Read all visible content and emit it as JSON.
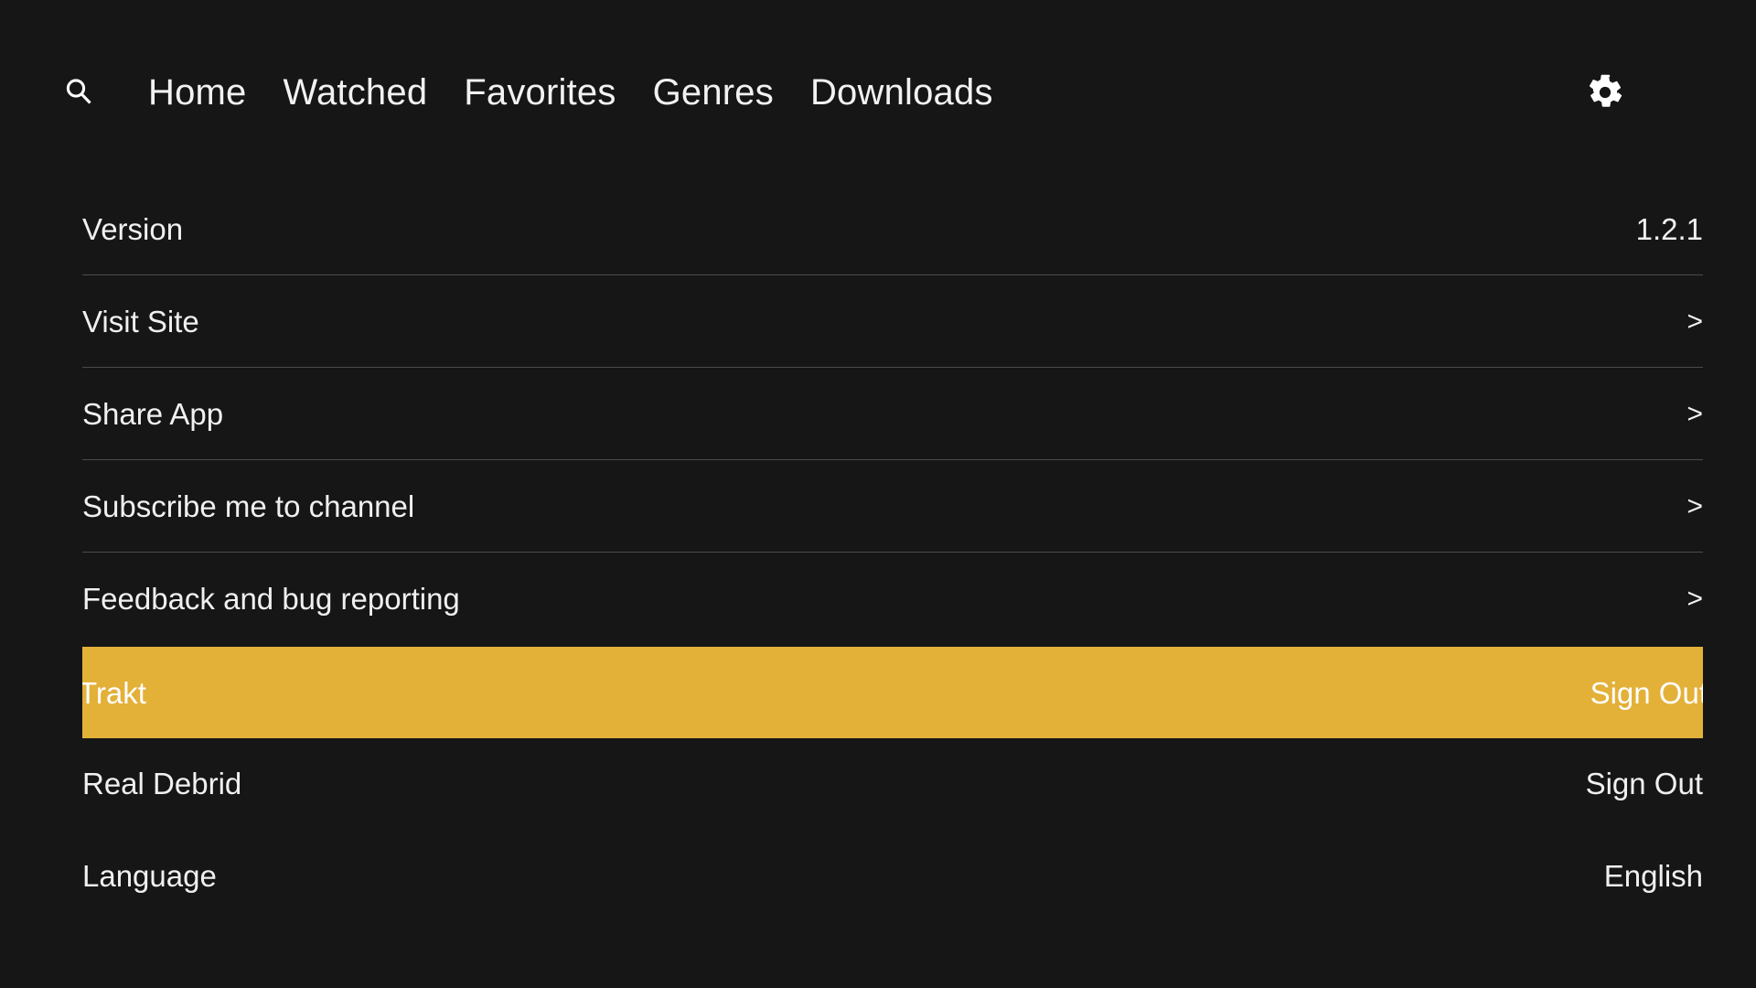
{
  "nav": {
    "search_icon": "search-icon",
    "settings_icon": "gear-icon",
    "items": [
      {
        "label": "Home"
      },
      {
        "label": "Watched"
      },
      {
        "label": "Favorites"
      },
      {
        "label": "Genres"
      },
      {
        "label": "Downloads"
      }
    ]
  },
  "colors": {
    "background": "#161616",
    "text": "#f0f0f0",
    "divider": "#4b4b4b",
    "highlight": "#e3b038",
    "highlight_text": "#ffffff"
  },
  "settings": {
    "rows": [
      {
        "label": "Version",
        "value": "1.2.1",
        "value_type": "text",
        "selected": false,
        "divider": true
      },
      {
        "label": "Visit Site",
        "value": ">",
        "value_type": "chevron",
        "selected": false,
        "divider": true
      },
      {
        "label": "Share App",
        "value": ">",
        "value_type": "chevron",
        "selected": false,
        "divider": true
      },
      {
        "label": "Subscribe me to channel",
        "value": ">",
        "value_type": "chevron",
        "selected": false,
        "divider": true
      },
      {
        "label": "Feedback and bug reporting",
        "value": ">",
        "value_type": "chevron",
        "selected": false,
        "divider": false
      },
      {
        "label": "Trakt",
        "value": "Sign Out",
        "value_type": "text",
        "selected": true,
        "divider": false
      },
      {
        "label": "Real Debrid",
        "value": "Sign Out",
        "value_type": "text",
        "selected": false,
        "divider": false
      },
      {
        "label": "Language",
        "value": "English",
        "value_type": "text",
        "selected": false,
        "divider": false
      }
    ]
  }
}
